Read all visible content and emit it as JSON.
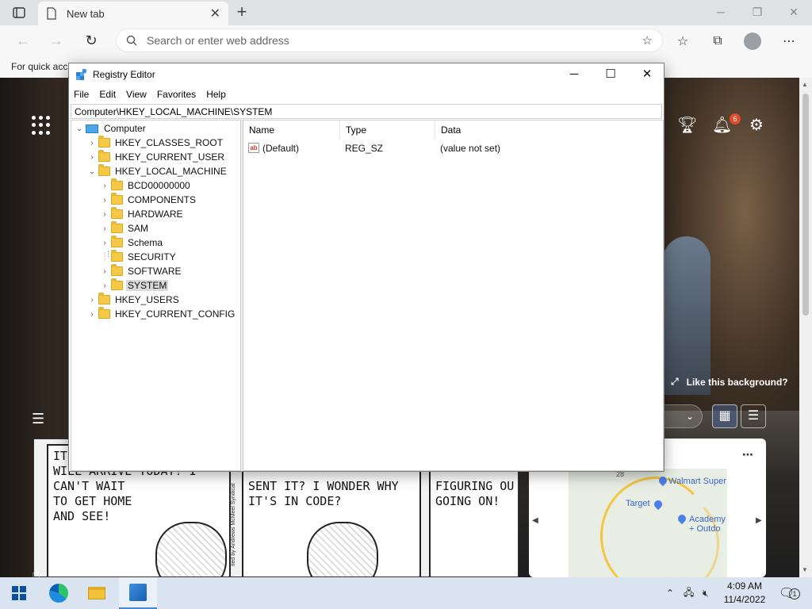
{
  "browser": {
    "tab_title": "New tab",
    "address_placeholder": "Search or enter web address",
    "favorites_bar_text": "For quick acc"
  },
  "newtab": {
    "notification_count": "6",
    "like_background": "Like this background?"
  },
  "comic": {
    "panel1": [
      "IT",
      "WILL ARRIVE TODAY! I",
      "CAN'T WAIT",
      "TO GET HOME",
      "AND SEE!"
    ],
    "panel2": [
      "SENT IT? I WONDER WHY",
      "IT'S IN CODE?"
    ],
    "panel3": [
      "FIGURING OU",
      "GOING ON!"
    ],
    "credit": "ited by Andrews McMeel Syndicat"
  },
  "map": {
    "labels": [
      "Walmart Super",
      "Target",
      "Academy",
      "+ Outdo"
    ],
    "route": "28"
  },
  "registry": {
    "title": "Registry Editor",
    "menu": [
      "File",
      "Edit",
      "View",
      "Favorites",
      "Help"
    ],
    "path": "Computer\\HKEY_LOCAL_MACHINE\\SYSTEM",
    "tree": {
      "root": "Computer",
      "hives": [
        "HKEY_CLASSES_ROOT",
        "HKEY_CURRENT_USER",
        "HKEY_LOCAL_MACHINE",
        "HKEY_USERS",
        "HKEY_CURRENT_CONFIG"
      ],
      "hklm_children": [
        "BCD00000000",
        "COMPONENTS",
        "HARDWARE",
        "SAM",
        "Schema",
        "SECURITY",
        "SOFTWARE",
        "SYSTEM"
      ],
      "selected": "SYSTEM"
    },
    "columns": [
      "Name",
      "Type",
      "Data"
    ],
    "values": [
      {
        "name": "(Default)",
        "type": "REG_SZ",
        "data": "(value not set)"
      }
    ]
  },
  "taskbar": {
    "time": "4:09 AM",
    "date": "11/4/2022",
    "notification_badge": "1"
  }
}
